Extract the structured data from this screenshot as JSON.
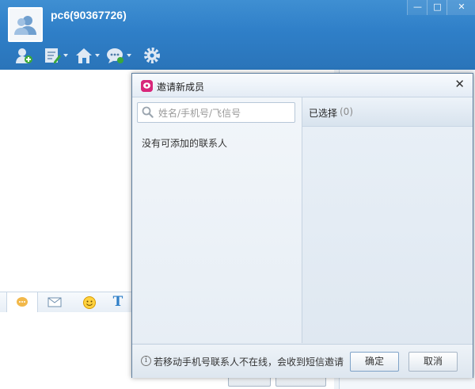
{
  "window": {
    "user_title": "pc6(90367726)",
    "controls": {
      "minimize": "—",
      "maximize": "□",
      "close": "✕"
    }
  },
  "toolbar": {
    "icons": [
      "add-contact-icon",
      "edit-icon",
      "home-icon",
      "chat-bubble-icon",
      "gear-icon"
    ]
  },
  "chat_tabs": [
    "emoji-bubble-icon",
    "mail-icon",
    "smiley-icon",
    "text-format-icon"
  ],
  "text_format_glyph": "T",
  "dialog": {
    "title": "邀请新成员",
    "close_glyph": "✕",
    "search": {
      "placeholder": "姓名/手机号/飞信号",
      "value": ""
    },
    "empty_message": "没有可添加的联系人",
    "selected": {
      "label": "已选择",
      "count": "(0)"
    },
    "footer_note": "若移动手机号联系人不在线，会收到短信邀请",
    "info_glyph": "i",
    "ok_label": "确定",
    "cancel_label": "取消"
  },
  "colors": {
    "header_blue": "#2f7fc8",
    "brand_pink": "#d8277a"
  }
}
